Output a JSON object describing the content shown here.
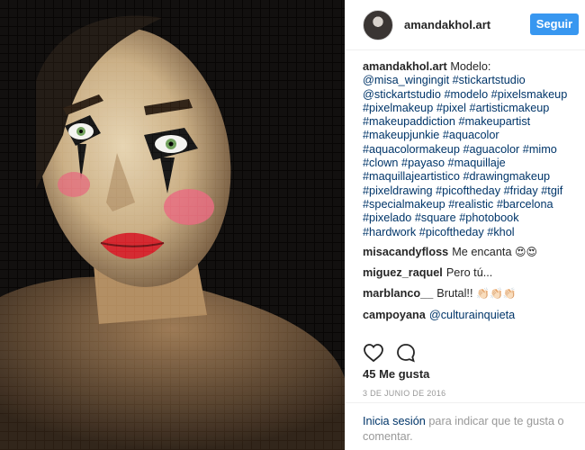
{
  "post": {
    "username": "amandakhol.art",
    "follow_label": "Seguir",
    "caption": {
      "author": "amandakhol.art",
      "text_before": "Modelo: ",
      "tags": [
        "@misa_wingingit",
        "#stickartstudio",
        "@stickartstudio",
        "#modelo",
        "#pixelsmakeup",
        "#pixelmakeup",
        "#pixel",
        "#artisticmakeup",
        "#makeupaddiction",
        "#makeupartist",
        "#makeupjunkie",
        "#aquacolor",
        "#aquacolormakeup",
        "#aguacolor",
        "#mimo",
        "#clown",
        "#payaso",
        "#maquillaje",
        "#maquillajeartistico",
        "#drawingmakeup",
        "#pixeldrawing",
        "#picoftheday",
        "#friday",
        "#tgif",
        "#specialmakeup",
        "#realistic",
        "#barcelona",
        "#pixelado",
        "#square",
        "#photobook",
        "#hardwork",
        "#picoftheday",
        "#khol"
      ]
    },
    "comments": [
      {
        "user": "misacandyfloss",
        "text": "Me encanta ",
        "emoji": "😍😍"
      },
      {
        "user": "miguez_raquel",
        "text": "Pero tú...",
        "emoji": ""
      },
      {
        "user": "marblanco__",
        "text": "Brutal!! ",
        "emoji": "👏🏻👏🏻👏🏻"
      },
      {
        "user": "campoyana",
        "text": "",
        "mention": "@culturainquieta",
        "emoji": ""
      }
    ],
    "likes_label": "45 Me gusta",
    "date_label": "3 DE JUNIO DE 2016",
    "login": {
      "link": "Inicia sesión",
      "text": " para indicar que te gusta o comentar."
    }
  },
  "icons": {
    "like": "heart-outline-icon",
    "comment": "comment-bubble-icon"
  },
  "colors": {
    "accent": "#3897f0",
    "link": "#003569",
    "muted": "#999999",
    "text": "#262626",
    "divider": "#efefef"
  }
}
